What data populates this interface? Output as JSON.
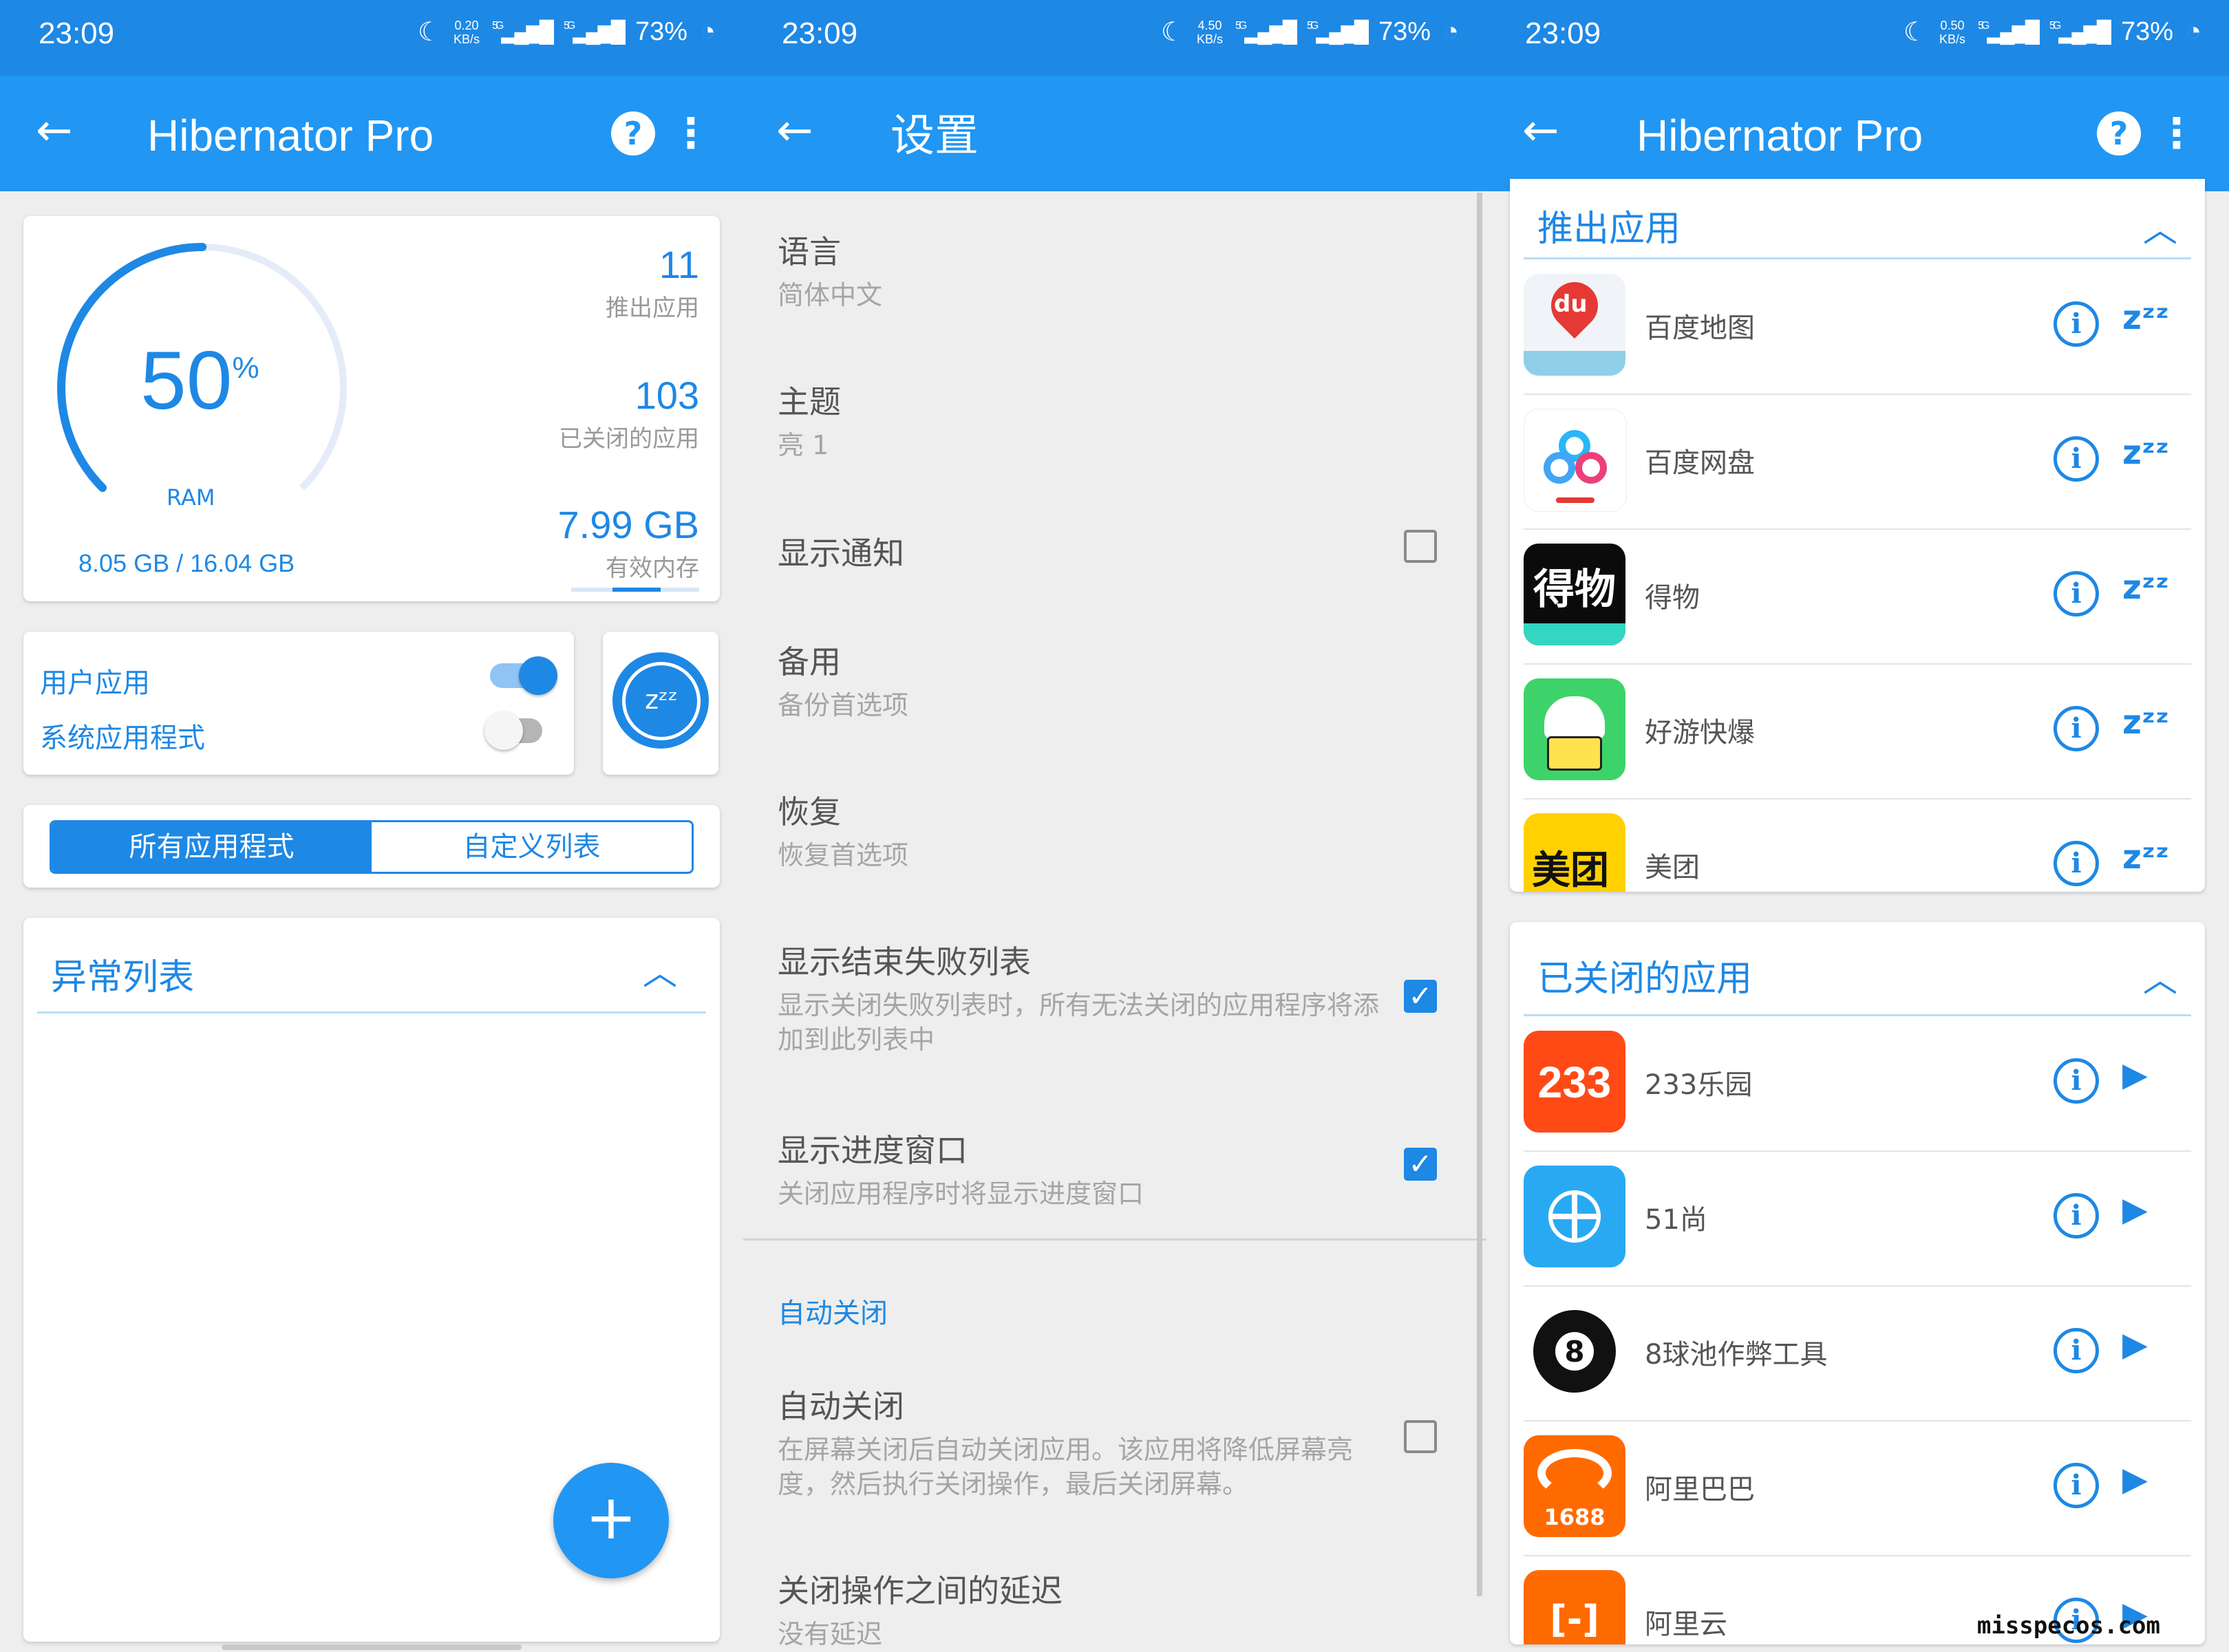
{
  "colors": {
    "status_bar": "#1e88e5",
    "app_bar": "#2196f3",
    "accent": "#1e88e5",
    "background": "#eeeeee"
  },
  "status": {
    "time": "23:09",
    "speed1": "0.20",
    "speed2": "4.50",
    "speed3": "0.50",
    "speed_unit": "KB/s",
    "net": "5G",
    "battery": "73%"
  },
  "main": {
    "title": "Hibernator Pro",
    "help": "?",
    "ram_percent": "50",
    "ram_percent_sign": "%",
    "ram_fill": 0.5,
    "ram_label": "RAM",
    "ram_usage": "8.05 GB / 16.04 GB",
    "stats": [
      {
        "value": "11",
        "label": "推出应用"
      },
      {
        "value": "103",
        "label": "已关闭的应用"
      },
      {
        "value": "7.99 GB",
        "label": "有效内存"
      }
    ],
    "user_apps": "用户应用",
    "user_apps_on": true,
    "system_apps": "系统应用程式",
    "system_apps_on": false,
    "hibernate_icon": "zzz-icon",
    "tab_all": "所有应用程式",
    "tab_custom": "自定义列表",
    "exception_title": "异常列表",
    "fab": "+"
  },
  "settings": {
    "title": "设置",
    "items": [
      {
        "title": "语言",
        "sub": "简体中文"
      },
      {
        "title": "主题",
        "sub": "亮 1"
      },
      {
        "title": "显示通知",
        "checked": false
      },
      {
        "title": "备用",
        "sub": "备份首选项"
      },
      {
        "title": "恢复",
        "sub": "恢复首选项"
      },
      {
        "title": "显示结束失败列表",
        "sub": "显示关闭失败列表时，所有无法关闭的应用程序将添加到此列表中",
        "checked": true
      },
      {
        "title": "显示进度窗口",
        "sub": "关闭应用程序时将显示进度窗口",
        "checked": true
      },
      {
        "title": "自动关闭",
        "sub": "在屏幕关闭后自动关闭应用。该应用将降低屏幕亮度，然后执行关闭操作，最后关闭屏幕。",
        "checked": false
      },
      {
        "title": "关闭操作之间的延迟",
        "sub": "没有延迟"
      }
    ],
    "section_auto": "自动关闭"
  },
  "lists": {
    "title": "Hibernator Pro",
    "running_title": "推出应用",
    "running_apps": [
      {
        "name": "百度地图",
        "icon": "baidu-maps-icon",
        "icon_text": "du"
      },
      {
        "name": "百度网盘",
        "icon": "baidu-netdisk-icon",
        "icon_text": ""
      },
      {
        "name": "得物",
        "icon": "dewu-icon",
        "icon_text": "得物"
      },
      {
        "name": "好游快爆",
        "icon": "haoyou-icon",
        "icon_text": ""
      },
      {
        "name": "美团",
        "icon": "meituan-icon",
        "icon_text": "美团"
      }
    ],
    "closed_title": "已关闭的应用",
    "closed_apps": [
      {
        "name": "233乐园",
        "icon": "233-leyuan-icon",
        "icon_text": "233"
      },
      {
        "name": "51尚",
        "icon": "51shang-icon",
        "icon_text": ""
      },
      {
        "name": "8球池作弊工具",
        "icon": "8ball-icon",
        "icon_text": "8"
      },
      {
        "name": "阿里巴巴",
        "icon": "alibaba-icon",
        "icon_text": "1688"
      },
      {
        "name": "阿里云",
        "icon": "aliyun-icon",
        "icon_text": "[-]"
      }
    ],
    "info_glyph": "i",
    "sleep_glyph": "zᶻᶻ",
    "play_glyph": "▶"
  },
  "watermark": "misspecos.com"
}
